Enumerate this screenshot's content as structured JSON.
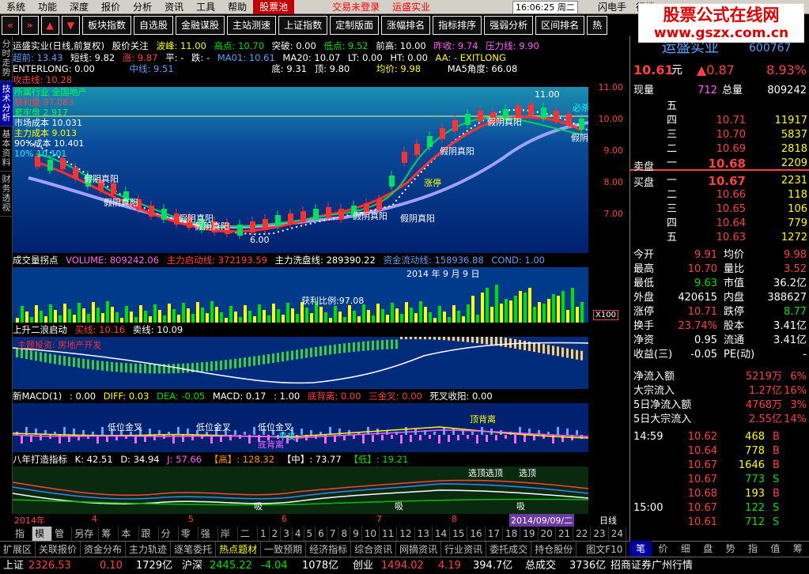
{
  "menu": {
    "items": [
      "系统",
      "功能",
      "深度",
      "报价",
      "分析",
      "资讯",
      "工具",
      "帮助"
    ],
    "active": "股票池",
    "alert1": "交易未登录",
    "alert2": "运盛实业",
    "clock": "16:06:25 周二",
    "r1": "闪电手",
    "r2": "行情"
  },
  "toolbar": {
    "buttons": [
      "板块指数",
      "自选股",
      "金融谋股",
      "主站测速",
      "上证指数",
      "定制版面",
      "涨幅排名",
      "指标排序",
      "强弱分析",
      "区间排名"
    ],
    "more": "热"
  },
  "logo": {
    "line1": "股票公式在线网",
    "line2": "www.gszx.com.cn"
  },
  "lefttabs": [
    "分时走势",
    "技术分析",
    "基本资料",
    "财务透视"
  ],
  "main": {
    "head1": [
      "运盛实业(日线,前复权)",
      "股价关注",
      "波峰: 11.00",
      "高点: 10.70",
      "突破: 0.00",
      "低点: 9.52",
      "前高: 10.00",
      "昨收: 9.74",
      "压力线: 9.90"
    ],
    "head2": [
      "超前: 13.43",
      "短线: 9.82",
      "涨: 9.87",
      "平: -",
      "跌: -",
      "MA01: 10.61",
      "MA20: 10.07",
      "LT: 0.00",
      "HT: 0.00",
      "AA: - EXITLONG"
    ],
    "head3": [
      "ENTERLONG: 0.00",
      "中线: 9.51",
      "底: 9.31",
      "顶: 9.80",
      "均价: 9.98",
      "MA5角度: 66.08"
    ],
    "head4": [
      "攻击线: 10.28"
    ],
    "overlay": [
      "所属行业 全国地产",
      "获利盘 97.083",
      "套牢盘 2.917",
      "市场成本 10.031",
      "主力成本 9.013",
      "90%成本 10.401",
      "10% 10.101"
    ],
    "labels": [
      "假阴真阳",
      "假阴真阳",
      "假阴真阳",
      "假阴真阳",
      "假阴真阳",
      "假阴真阳",
      "假阴真阳",
      "假阴真阳",
      "假阴",
      "必杀",
      "买",
      "涨停",
      "11.00",
      "6.00"
    ],
    "yticks": [
      "11.00",
      "10.00",
      "9.00",
      "8.00",
      "7.00"
    ]
  },
  "volpanel": {
    "head": [
      "成交量拐点",
      "VOLUME: 809242.06",
      "主力启动线: 372193.59",
      "主力洗盘线: 289390.22",
      "资金流动线: 158936.88",
      "COND: 1.00"
    ],
    "date": "2014 年 9 月 9 日",
    "profit": "获利比例:97.08",
    "x100": "X100"
  },
  "wave": {
    "head": [
      "上升二浪启动",
      "买线: 10.16",
      "卖线: 10.09"
    ],
    "note": "主题投资: 房地产开发"
  },
  "macd": {
    "head": [
      "新MACD(1)",
      ": 0.00",
      "DIFF: 0.03",
      "DEA: -0.05",
      "MACD: 0.17",
      ": 1.00",
      "底背离: 0.00",
      "三金叉: 0.00",
      "死叉收阳: 0.00"
    ],
    "labels": [
      "低位金叉",
      "低位金叉",
      "低位金叉",
      "顶背离",
      "底背离",
      "平叉"
    ]
  },
  "eight": {
    "head": [
      "八年打造指标",
      "K: 42.51",
      "D: 34.94",
      "J: 57.66",
      "【高】: 128.32",
      "【中】: 73.77",
      "【低】: 19.21"
    ],
    "labels": [
      "选顶选顶",
      "选顶",
      "吸",
      "吸",
      "吸"
    ]
  },
  "xaxis": [
    "2014年",
    "4",
    "5",
    "6",
    "7",
    "8"
  ],
  "xdate": "2014/09/09/二",
  "xday": "日线",
  "bottomtabs": [
    "指标",
    "模板",
    "管理",
    "另存为",
    "筹码",
    "本股",
    "跟踪",
    "分布",
    "零轴",
    "强势",
    "岸边",
    "二浪",
    "1",
    "2",
    "3",
    "4",
    "5",
    "6",
    "7",
    "8",
    "9",
    "10",
    "11",
    "12",
    "13",
    "14",
    "15",
    "16",
    "17",
    "18",
    "19",
    "20",
    "21",
    "22",
    "23",
    "24"
  ],
  "statusbar": [
    "扩展区",
    "关联报价",
    "资金分布",
    "主力轨迹",
    "逐笔委托",
    "热点题材",
    "一致预期",
    "经济指标",
    "综合资讯",
    "网摘资讯",
    "行业资讯",
    "委托成交",
    "持仓股份"
  ],
  "statusmore": "图文F10",
  "rtabs": [
    "笔",
    "价",
    "细",
    "盘",
    "势",
    "指",
    "值",
    "筹"
  ],
  "quote": {
    "name": "运盛实业",
    "code": "600767",
    "price": "10.61",
    "unit": "元",
    "chg": "▲0.87",
    "pct": "8.93%",
    "xianliang_l": "现量",
    "xianliang": "712",
    "zongliang_l": "总量",
    "zongliang": "809242",
    "asks": [
      {
        "l": "五",
        "p": "",
        "v": ""
      },
      {
        "l": "四",
        "p": "10.71",
        "v": "11917"
      },
      {
        "l": "三",
        "p": "10.70",
        "v": "5837"
      },
      {
        "l": "二",
        "p": "10.69",
        "v": "2818"
      },
      {
        "l": "一",
        "p": "10.68",
        "v": "2209"
      }
    ],
    "bids": [
      {
        "l": "一",
        "p": "10.67",
        "v": "2231"
      },
      {
        "l": "二",
        "p": "10.66",
        "v": "118"
      },
      {
        "l": "三",
        "p": "10.65",
        "v": "106"
      },
      {
        "l": "四",
        "p": "10.64",
        "v": "779"
      },
      {
        "l": "五",
        "p": "10.63",
        "v": "1272"
      }
    ],
    "sell_l": "卖盘",
    "buy_l": "买盘",
    "stats": [
      [
        "今开",
        "9.91",
        "均价",
        "9.98"
      ],
      [
        "最高",
        "10.70",
        "量比",
        "3.52"
      ],
      [
        "最低",
        "9.63",
        "市值",
        "36.2亿"
      ],
      [
        "外盘",
        "420615",
        "内盘",
        "388627"
      ],
      [
        "涨停",
        "10.71",
        "跌停",
        "8.77"
      ],
      [
        "换手",
        "23.74%",
        "股本",
        "3.41亿"
      ],
      [
        "净资",
        "0.95",
        "流通",
        "3.41亿"
      ],
      [
        "收益(三)",
        "-0.05",
        "PE(动)",
        "-"
      ]
    ],
    "flows": [
      [
        "净流入额",
        "5219万",
        "6%"
      ],
      [
        "大宗流入",
        "1.27亿",
        "16%"
      ],
      [
        "5日净流入额",
        "4768万",
        "3%"
      ],
      [
        "5日大宗流入",
        "2.55亿",
        "14%"
      ]
    ],
    "ticks": [
      [
        "14:59",
        "10.62",
        "468",
        "B"
      ],
      [
        "",
        "10.64",
        "778",
        "B"
      ],
      [
        "",
        "10.67",
        "1646",
        "B"
      ],
      [
        "",
        "10.67",
        "773",
        "S"
      ],
      [
        "",
        "10.68",
        "193",
        "B"
      ],
      [
        "15:00",
        "10.67",
        "122",
        "S"
      ],
      [
        "",
        "10.61",
        "712",
        "S"
      ]
    ]
  },
  "indexbar": {
    "sh_l": "上证",
    "sh": "2326.53",
    "sh_c": "0.10",
    "sh_v": "1729亿",
    "sz_l": "沪深",
    "sz": "2445.22",
    "sz_c": "-4.04",
    "sz_v": "1078亿",
    "cy_l": "创业",
    "cy": "1494.02",
    "cy_c": "4.19",
    "cy_v": "394.7亿",
    "tot_l": "总成交",
    "tot": "3736亿",
    "broker": "招商证券广州行情"
  },
  "colors": {
    "up": "#ff4040",
    "down": "#00e000",
    "panel": "#002a7a",
    "accent": "#ffff00"
  }
}
